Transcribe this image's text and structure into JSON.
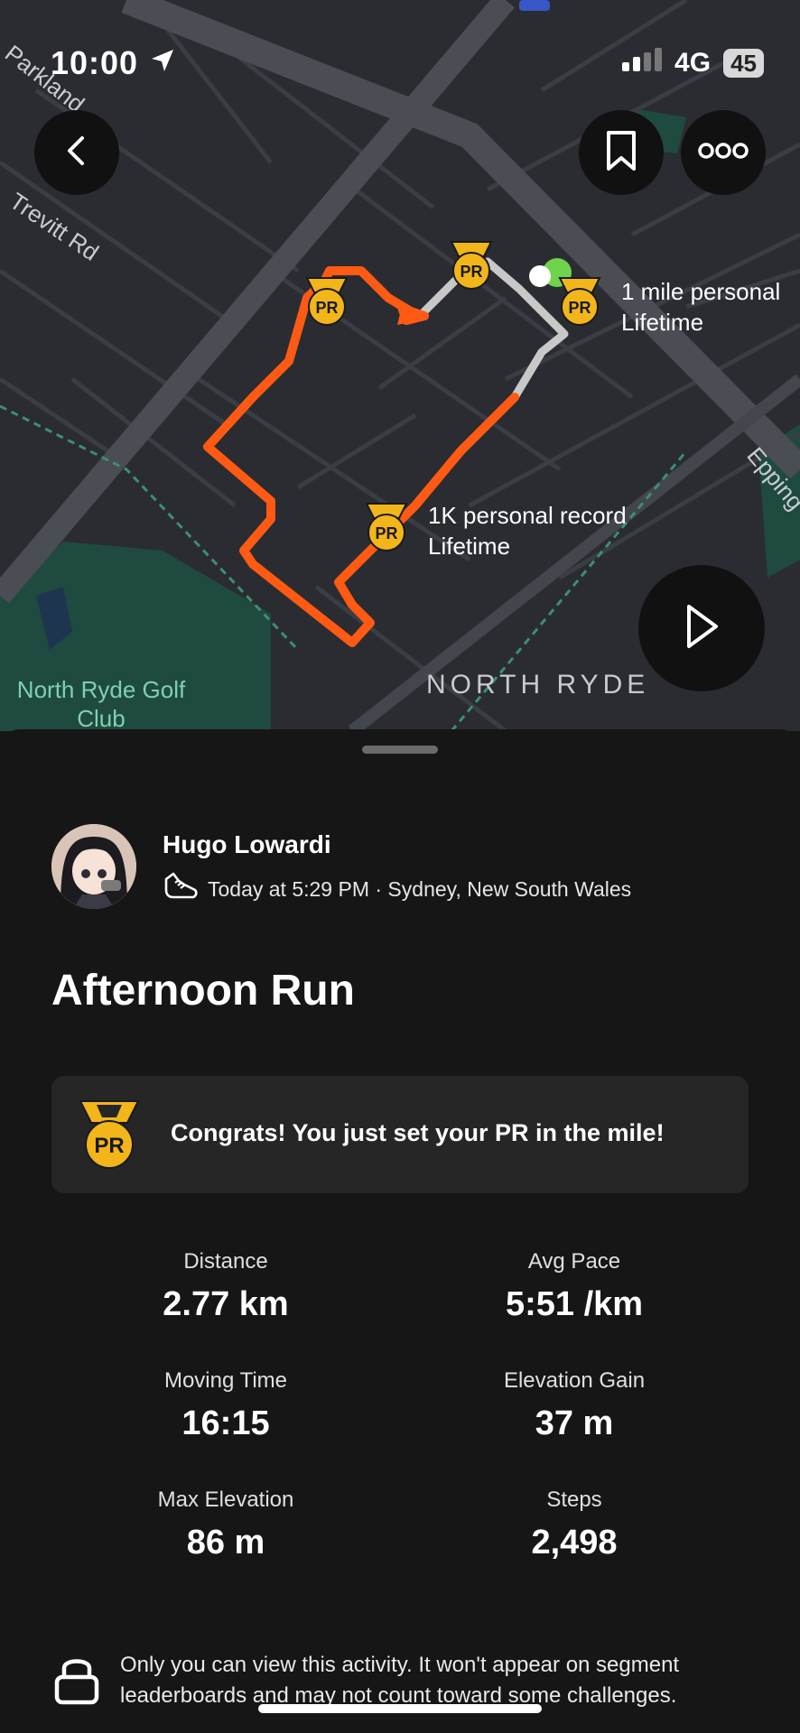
{
  "status_bar": {
    "time": "10:00",
    "network": "4G",
    "battery": "45"
  },
  "map": {
    "labels": {
      "parkland": "Parkland",
      "trevitt": "Trevitt Rd",
      "epping": "Epping",
      "golf_club": "North Ryde Golf Club",
      "suburb": "NORTH RYDE"
    },
    "pr_markers": {
      "mile": {
        "title": "1 mile personal",
        "sub": "Lifetime"
      },
      "k1": {
        "title": "1K personal record",
        "sub": "Lifetime"
      }
    },
    "badge_text": "PR",
    "route_color": "#ff5a14"
  },
  "activity": {
    "athlete": "Hugo Lowardi",
    "meta": "Today at 5:29 PM · Sydney, New South Wales",
    "title": "Afternoon Run",
    "pr_message": "Congrats! You just set your PR in the mile!",
    "stats": [
      {
        "label": "Distance",
        "value": "2.77 km"
      },
      {
        "label": "Avg Pace",
        "value": "5:51 /km"
      },
      {
        "label": "Moving Time",
        "value": "16:15"
      },
      {
        "label": "Elevation Gain",
        "value": "37 m"
      },
      {
        "label": "Max Elevation",
        "value": "86 m"
      },
      {
        "label": "Steps",
        "value": "2,498"
      }
    ],
    "privacy_note": "Only you can view this activity. It won't appear on segment leaderboards and may not count toward some challenges."
  },
  "icons": [
    "back-icon",
    "bookmark-icon",
    "more-icon",
    "play-icon",
    "shoe-icon",
    "lock-icon",
    "pr-medal-icon"
  ]
}
